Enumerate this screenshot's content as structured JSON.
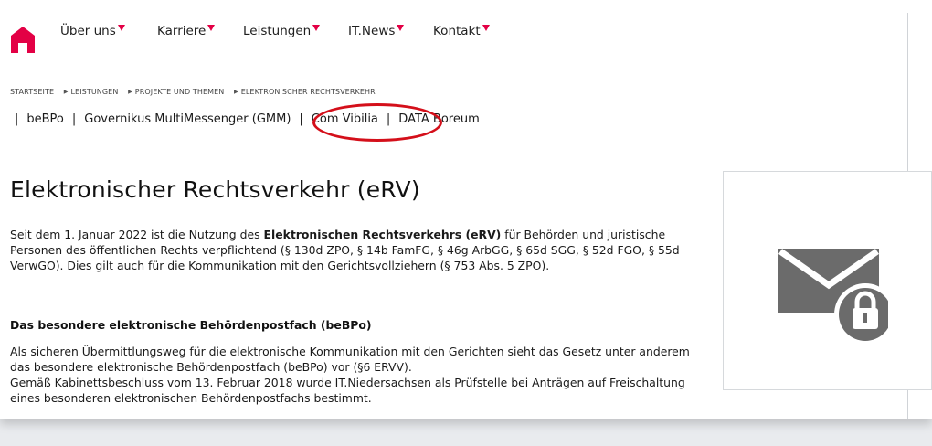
{
  "nav": {
    "home_icon": "home-icon",
    "items": [
      {
        "label": "Über uns"
      },
      {
        "label": "Karriere"
      },
      {
        "label": "Leistungen"
      },
      {
        "label": "IT.News"
      },
      {
        "label": "Kontakt"
      }
    ],
    "accent_color": "#e30045"
  },
  "breadcrumb": {
    "items": [
      "STARTSEITE",
      "LEISTUNGEN",
      "PROJEKTE UND THEMEN",
      "ELEKTRONISCHER RECHTSVERKEHR"
    ]
  },
  "subnav": {
    "links": [
      "beBPo",
      "Governikus MultiMessenger (GMM)",
      "Com Vibilia",
      "DATA Boreum"
    ],
    "highlight_color": "#d40f1a"
  },
  "content": {
    "title": "Elektronischer Rechtsverkehr (eRV)",
    "p1_before": "Seit dem 1. Januar 2022 ist die Nutzung des ",
    "p1_bold": "Elektronischen Rechtsverkehrs (eRV)",
    "p1_after": " für Behörden und juristische Personen des öffentlichen Rechts verpflichtend (§ 130d ZPO, § 14b FamFG, § 46g ArbGG, § 65d SGG, § 52d FGO, § 55d VerwGO). Dies gilt auch für die Kommunikation mit den Gerichtsvollziehern (§ 753 Abs. 5 ZPO).",
    "section_heading": "Das besondere elektronische Behördenpostfach (beBPo)",
    "p2_line1": "Als sicheren Übermittlungsweg für die elektronische Kommunikation mit den Gerichten sieht das Gesetz unter anderem das besondere elektronische Behördenpostfach (beBPo) vor (§6 ERVV).",
    "p2_line2": "Gemäß Kabinettsbeschluss vom 13. Februar 2018 wurde IT.Niedersachsen als Prüfstelle bei Anträgen auf Freischaltung eines besonderen elektronischen Behördenpostfachs bestimmt."
  },
  "sidebar": {
    "icon": "mail-lock-icon",
    "icon_color": "#6b6b6b"
  }
}
